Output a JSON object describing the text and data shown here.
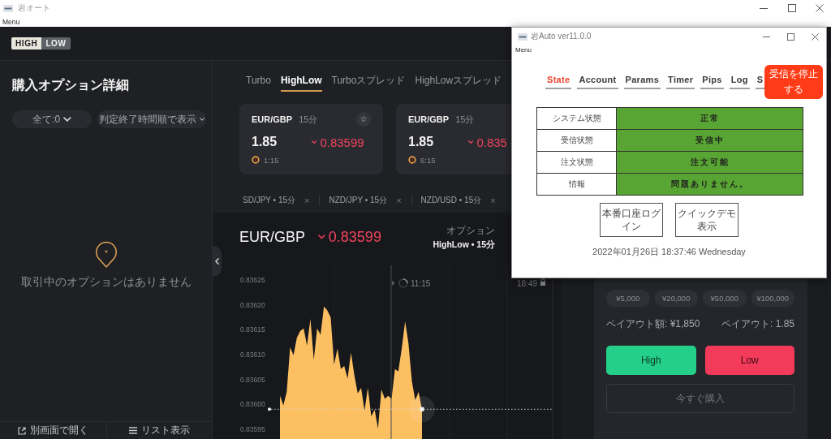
{
  "window": {
    "title": "岩オート",
    "menu": "Menu"
  },
  "header": {
    "logo": [
      "HIGH",
      "LOW"
    ]
  },
  "options_panel": {
    "title": "購入オプション詳細",
    "filters": [
      "全て:0",
      "判定終了時間順で表示"
    ],
    "empty_message": "取引中のオプションはありません",
    "footer": [
      {
        "label": "別画面で開く",
        "kind": "window"
      },
      {
        "label": "リスト表示",
        "kind": "list"
      }
    ]
  },
  "product_tabs": [
    {
      "label": "Turbo",
      "selected": false
    },
    {
      "label": "HighLow",
      "selected": true
    },
    {
      "label": "Turboスプレッド",
      "selected": false
    },
    {
      "label": "HighLowスプレッド",
      "selected": false
    }
  ],
  "asset_cards": [
    {
      "pair": "EUR/GBP",
      "duration": "15分",
      "star": "☆",
      "payout": "1.85",
      "falling": true,
      "rate": "0.83599",
      "time_left": "1:15"
    },
    {
      "pair": "EUR/GBP",
      "duration": "15分",
      "payout": "1.85",
      "falling": true,
      "rate": "0.835",
      "time_left": "6:15"
    }
  ],
  "asset_strip": [
    {
      "label": "SD/JPY • 15分",
      "close": "×"
    },
    {
      "label": "NZD/JPY • 15分",
      "close": "×"
    },
    {
      "label": "NZD/USD • 15分",
      "close": "×"
    }
  ],
  "chart_panel": {
    "pair": "EUR/GBP",
    "falling": true,
    "rate": "0.83599",
    "option_label": "オプション",
    "option_value": "HighLow • 15分",
    "current_time": "11:15",
    "close_time": "18:49",
    "chart_data": {
      "type": "area",
      "ylim": [
        0.83593,
        0.83628
      ],
      "yticks": [
        {
          "value": 0.83625,
          "label": "0.83625"
        },
        {
          "value": 0.8362,
          "label": "0.83620"
        },
        {
          "value": 0.83615,
          "label": "0.83615"
        },
        {
          "value": 0.8361,
          "label": "0.83610"
        },
        {
          "value": 0.83605,
          "label": "0.83605"
        },
        {
          "value": 0.836,
          "label": "0.83600"
        },
        {
          "value": 0.83595,
          "label": "0.83595"
        }
      ],
      "categories": [
        null,
        null,
        null,
        null,
        null,
        null,
        null,
        null,
        null,
        null,
        null,
        null,
        null,
        null,
        null,
        null,
        null,
        null,
        null,
        null,
        null,
        null,
        null,
        null,
        null,
        null,
        null,
        null,
        null,
        null,
        null,
        null,
        null,
        null,
        null,
        null,
        null,
        null,
        null,
        null,
        null,
        null,
        null
      ],
      "series": [
        {
          "color": "#fcbf62",
          "values": [
            0.836017,
            0.835998,
            0.836025,
            0.836115,
            0.836099,
            0.836134,
            0.836148,
            0.836153,
            0.836118,
            0.836172,
            0.83609,
            0.836153,
            0.83614,
            0.836197,
            0.836189,
            0.836175,
            0.83608,
            0.836112,
            0.836071,
            0.836077,
            0.836052,
            0.836104,
            0.836058,
            0.836022,
            0.836033,
            0.835987,
            0.836033,
            0.835976,
            0.835989,
            0.835951,
            0.83603,
            0.836011,
            0.836017,
            0.836011,
            0.836071,
            0.836066,
            0.836112,
            0.836167,
            0.836123,
            0.836047,
            0.836008,
            0.836025,
            0.83599
          ]
        }
      ]
    }
  },
  "trade_panel": {
    "amounts": [
      "¥5,000",
      "¥20,000",
      "¥50,000",
      "¥100,000"
    ],
    "payout_amount": "ペイアウト額: ¥1,850",
    "payout_rate": "ペイアウト: 1.85",
    "buttons": [
      {
        "label": "High",
        "kind": "high"
      },
      {
        "label": "Low",
        "kind": "low"
      },
      {
        "label": "今すぐ購入",
        "kind": "buy"
      }
    ]
  },
  "auto_window": {
    "title": "岩Auto ver11.0.0",
    "menu": "Menu",
    "tabs": [
      {
        "label": "State",
        "selected": true
      },
      {
        "label": "Account",
        "selected": false
      },
      {
        "label": "Params",
        "selected": false
      },
      {
        "label": "Timer",
        "selected": false
      },
      {
        "label": "Pips",
        "selected": false
      },
      {
        "label": "Log",
        "selected": false
      },
      {
        "label": "S",
        "selected": false
      }
    ],
    "stop_button": "受信を停止する",
    "status_table": [
      {
        "label": "システム状態",
        "value": "正常",
        "ok": true
      },
      {
        "label": "受信状態",
        "value": "受信中",
        "ok": true
      },
      {
        "label": "注文状態",
        "value": "注文可能",
        "ok": true
      },
      {
        "label": "情報",
        "value": "問題ありません。",
        "ok": true
      }
    ],
    "buttons": [
      "本番口座ログイン",
      "クイックデモ表示"
    ],
    "datetime": "2022年01月26日 18:37:46 Wednesday"
  }
}
